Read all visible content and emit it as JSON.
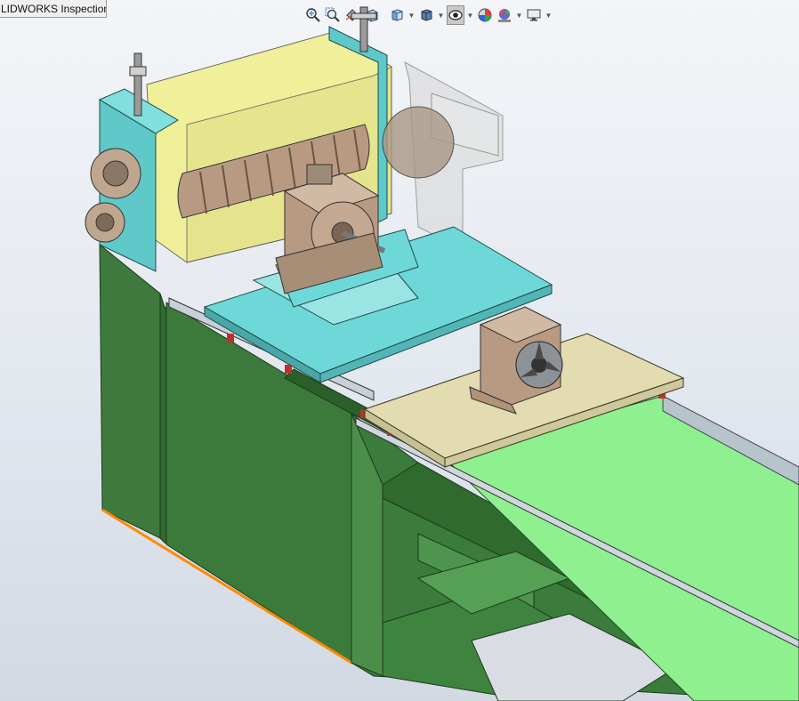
{
  "window": {
    "tab_title": "LIDWORKS Inspection"
  },
  "hud_toolbar": {
    "tools": [
      {
        "name": "zoom-to-fit-icon",
        "dropdown": false
      },
      {
        "name": "zoom-to-area-icon",
        "dropdown": false
      },
      {
        "name": "previous-view-icon",
        "dropdown": false
      },
      {
        "name": "section-view-icon",
        "dropdown": false
      },
      {
        "name": "view-orientation-icon",
        "dropdown": true
      },
      {
        "name": "display-style-icon",
        "dropdown": true
      },
      {
        "name": "hide-show-items-icon",
        "dropdown": true,
        "active": true
      },
      {
        "name": "edit-appearance-icon",
        "dropdown": false
      },
      {
        "name": "apply-scene-icon",
        "dropdown": true
      },
      {
        "name": "view-settings-icon",
        "dropdown": true
      }
    ]
  },
  "colors": {
    "frame_green": "#3e7a3e",
    "frame_green_dark": "#2d5e2d",
    "bed_green": "#8ef08e",
    "plate_cyan": "#6ed8d8",
    "roller_housing_yellow": "#f1f08a",
    "housing_brown": "#b89a82",
    "tan_plate": "#e3dcb0",
    "glass": "#dcdcdc",
    "edge_highlight": "#ff8a00"
  }
}
